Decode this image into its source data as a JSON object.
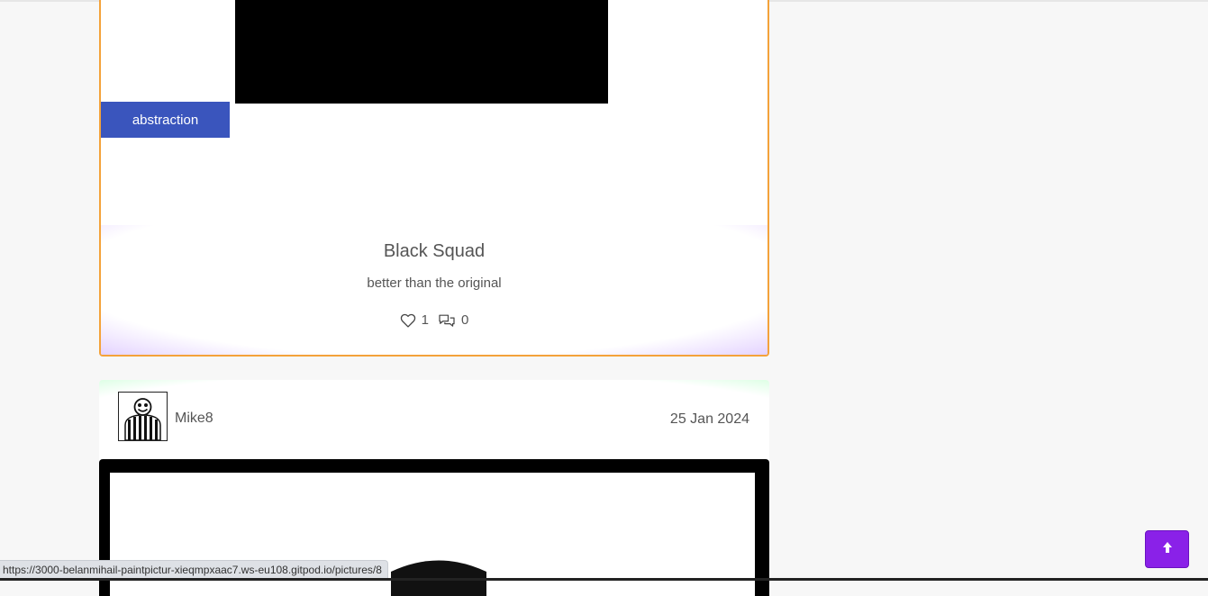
{
  "post_1": {
    "category": "abstraction",
    "title": "Black Squad",
    "description": "better than the original",
    "likes": "1",
    "comments": "0",
    "like_icon": "heart-icon",
    "comment_icon": "comments-icon"
  },
  "post_2": {
    "username": "Mike8",
    "date": "25 Jan 2024"
  },
  "status_bar": {
    "url": "https://3000-belanmihail-paintpictur-xieqmpxaac7.ws-eu108.gitpod.io/pictures/8"
  },
  "scroll_top": {
    "icon": "arrow-up-icon",
    "color": "#8a21e8"
  },
  "colors": {
    "card_border": "#f4a23a",
    "badge": "#3a55bd"
  }
}
